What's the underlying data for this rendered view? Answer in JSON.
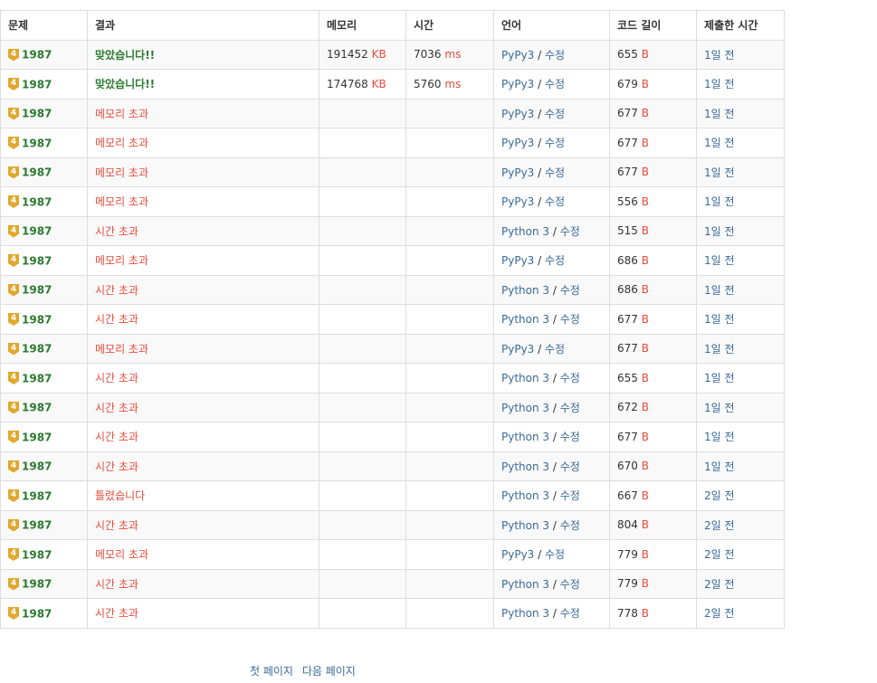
{
  "headers": [
    "문제",
    "결과",
    "메모리",
    "시간",
    "언어",
    "코드 길이",
    "제출한 시간"
  ],
  "units": {
    "memory": "KB",
    "time": "ms",
    "code": "B"
  },
  "tier_badge": "4",
  "edit_label": "수정",
  "rows": [
    {
      "problem": "1987",
      "result": "맞았습니다!!",
      "accepted": true,
      "memory": "191452",
      "time": "7036",
      "lang": "PyPy3",
      "len": "655",
      "when": "1일 전"
    },
    {
      "problem": "1987",
      "result": "맞았습니다!!",
      "accepted": true,
      "memory": "174768",
      "time": "5760",
      "lang": "PyPy3",
      "len": "679",
      "when": "1일 전"
    },
    {
      "problem": "1987",
      "result": "메모리 초과",
      "accepted": false,
      "memory": "",
      "time": "",
      "lang": "PyPy3",
      "len": "677",
      "when": "1일 전"
    },
    {
      "problem": "1987",
      "result": "메모리 초과",
      "accepted": false,
      "memory": "",
      "time": "",
      "lang": "PyPy3",
      "len": "677",
      "when": "1일 전"
    },
    {
      "problem": "1987",
      "result": "메모리 초과",
      "accepted": false,
      "memory": "",
      "time": "",
      "lang": "PyPy3",
      "len": "677",
      "when": "1일 전"
    },
    {
      "problem": "1987",
      "result": "메모리 초과",
      "accepted": false,
      "memory": "",
      "time": "",
      "lang": "PyPy3",
      "len": "556",
      "when": "1일 전"
    },
    {
      "problem": "1987",
      "result": "시간 초과",
      "accepted": false,
      "memory": "",
      "time": "",
      "lang": "Python 3",
      "len": "515",
      "when": "1일 전"
    },
    {
      "problem": "1987",
      "result": "메모리 초과",
      "accepted": false,
      "memory": "",
      "time": "",
      "lang": "PyPy3",
      "len": "686",
      "when": "1일 전"
    },
    {
      "problem": "1987",
      "result": "시간 초과",
      "accepted": false,
      "memory": "",
      "time": "",
      "lang": "Python 3",
      "len": "686",
      "when": "1일 전"
    },
    {
      "problem": "1987",
      "result": "시간 초과",
      "accepted": false,
      "memory": "",
      "time": "",
      "lang": "Python 3",
      "len": "677",
      "when": "1일 전"
    },
    {
      "problem": "1987",
      "result": "메모리 초과",
      "accepted": false,
      "memory": "",
      "time": "",
      "lang": "PyPy3",
      "len": "677",
      "when": "1일 전"
    },
    {
      "problem": "1987",
      "result": "시간 초과",
      "accepted": false,
      "memory": "",
      "time": "",
      "lang": "Python 3",
      "len": "655",
      "when": "1일 전"
    },
    {
      "problem": "1987",
      "result": "시간 초과",
      "accepted": false,
      "memory": "",
      "time": "",
      "lang": "Python 3",
      "len": "672",
      "when": "1일 전"
    },
    {
      "problem": "1987",
      "result": "시간 초과",
      "accepted": false,
      "memory": "",
      "time": "",
      "lang": "Python 3",
      "len": "677",
      "when": "1일 전"
    },
    {
      "problem": "1987",
      "result": "시간 초과",
      "accepted": false,
      "memory": "",
      "time": "",
      "lang": "Python 3",
      "len": "670",
      "when": "1일 전"
    },
    {
      "problem": "1987",
      "result": "틀렸습니다",
      "accepted": false,
      "memory": "",
      "time": "",
      "lang": "Python 3",
      "len": "667",
      "when": "2일 전"
    },
    {
      "problem": "1987",
      "result": "시간 초과",
      "accepted": false,
      "memory": "",
      "time": "",
      "lang": "Python 3",
      "len": "804",
      "when": "2일 전"
    },
    {
      "problem": "1987",
      "result": "메모리 초과",
      "accepted": false,
      "memory": "",
      "time": "",
      "lang": "PyPy3",
      "len": "779",
      "when": "2일 전"
    },
    {
      "problem": "1987",
      "result": "시간 초과",
      "accepted": false,
      "memory": "",
      "time": "",
      "lang": "Python 3",
      "len": "779",
      "when": "2일 전"
    },
    {
      "problem": "1987",
      "result": "시간 초과",
      "accepted": false,
      "memory": "",
      "time": "",
      "lang": "Python 3",
      "len": "778",
      "when": "2일 전"
    }
  ],
  "pager": {
    "first": "첫 페이지",
    "next": "다음 페이지"
  },
  "colors": {
    "accepted": "#2b7a2f",
    "error": "#e74c3c",
    "link": "#3a6a9a",
    "tier": "#e0a82e"
  }
}
